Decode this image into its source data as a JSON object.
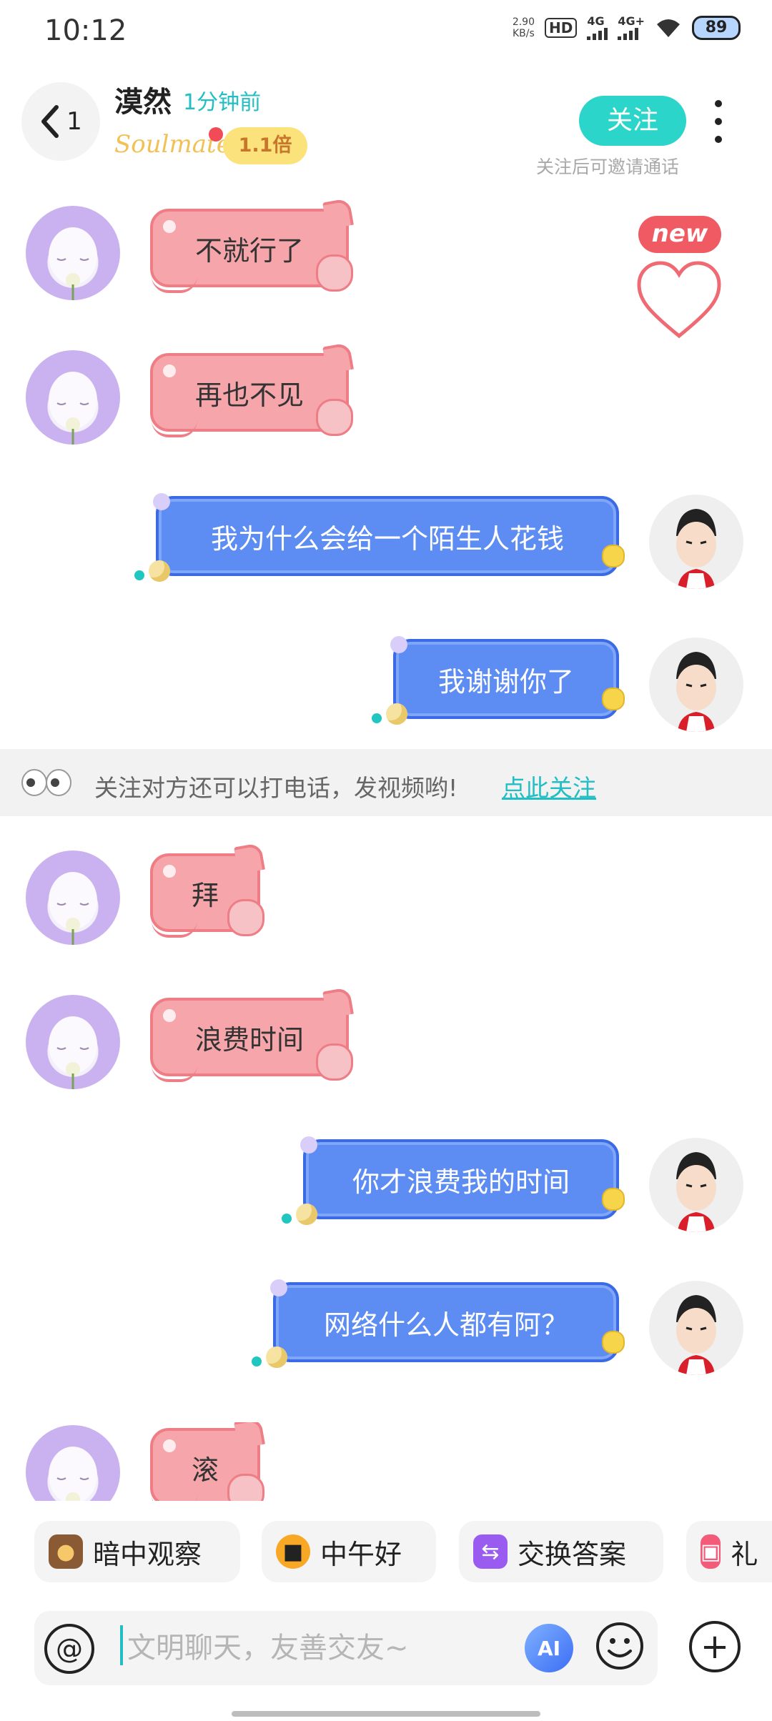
{
  "status_bar": {
    "time": "10:12",
    "net_speed_value": "2.90",
    "net_speed_unit": "KB/s",
    "hd": "HD",
    "sim1": "4G",
    "sim2": "4G+",
    "battery": "89"
  },
  "header": {
    "back_count": "1",
    "name": "漠然",
    "online_status": "1分钟前",
    "soulmate_logo": "Soulmate",
    "multiplier": "1.1倍",
    "follow_label": "关注",
    "follow_hint": "关注后可邀请通话"
  },
  "badge": {
    "new": "new"
  },
  "messages": [
    {
      "side": "in",
      "text": "不就行了"
    },
    {
      "side": "in",
      "text": "再也不见"
    },
    {
      "side": "out",
      "text": "我为什么会给一个陌生人花钱"
    },
    {
      "side": "out",
      "text": "我谢谢你了"
    },
    {
      "side": "in",
      "text": "拜"
    },
    {
      "side": "in",
      "text": "浪费时间"
    },
    {
      "side": "out",
      "text": "你才浪费我的时间"
    },
    {
      "side": "out",
      "text": "网络什么人都有阿？"
    },
    {
      "side": "in",
      "text": "滚"
    }
  ],
  "follow_tip": {
    "text": "关注对方还可以打电话，发视频哟!",
    "link": "点此关注"
  },
  "quick_replies": [
    {
      "label": "暗中观察",
      "icon": "peeking-dog-icon"
    },
    {
      "label": "中午好",
      "icon": "sun-sunglasses-icon"
    },
    {
      "label": "交换答案",
      "icon": "swap-icon"
    },
    {
      "label": "礼",
      "icon": "gift-icon"
    }
  ],
  "input": {
    "placeholder": "文明聊天，友善交友~"
  },
  "colors": {
    "accent_teal": "#2bd5c9",
    "incoming_bubble": "#f6a6aa",
    "outgoing_bubble": "#5d8df2",
    "new_badge": "#f05a63"
  }
}
